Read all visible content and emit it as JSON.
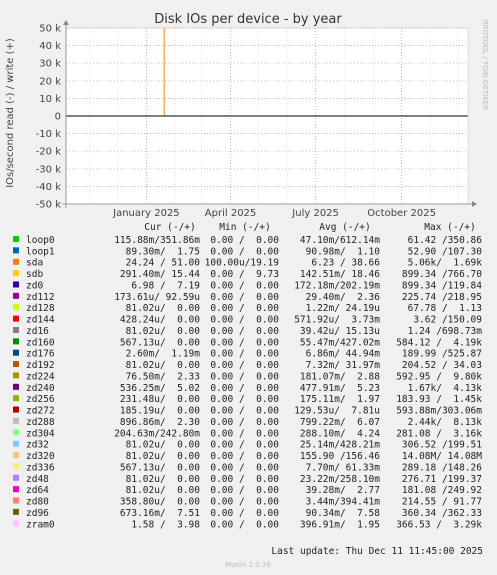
{
  "chart_data": {
    "type": "line",
    "title": "Disk IOs per device - by year",
    "ylabel": "IOs/second read (-) / write (+)",
    "side_label": "RRDTOOL / TOBI OETIKER",
    "ylim": [
      -50000,
      50000
    ],
    "y_ticks": [
      {
        "value": 50000,
        "label": "50 k"
      },
      {
        "value": 40000,
        "label": "40 k"
      },
      {
        "value": 30000,
        "label": "30 k"
      },
      {
        "value": 20000,
        "label": "20 k"
      },
      {
        "value": 10000,
        "label": "10 k"
      },
      {
        "value": 0,
        "label": "0"
      },
      {
        "value": -10000,
        "label": "-10 k"
      },
      {
        "value": -20000,
        "label": "-20 k"
      },
      {
        "value": -30000,
        "label": "-30 k"
      },
      {
        "value": -40000,
        "label": "-40 k"
      },
      {
        "value": -50000,
        "label": "-50 k"
      }
    ],
    "x_range": [
      "2024-10-07",
      "2025-12-11"
    ],
    "x_ticks": [
      {
        "value": "2025-01-01",
        "label": "January 2025"
      },
      {
        "value": "2025-04-01",
        "label": "April 2025"
      },
      {
        "value": "2025-07-01",
        "label": "July 2025"
      },
      {
        "value": "2025-10-01",
        "label": "October 2025"
      }
    ],
    "minor_x_ticks": [
      "2024-11-01",
      "2024-12-01",
      "2025-02-01",
      "2025-03-01",
      "2025-05-01",
      "2025-06-01",
      "2025-08-01",
      "2025-09-01",
      "2025-11-01",
      "2025-12-01"
    ],
    "spike": {
      "series": "sda",
      "x": "2025-01-20",
      "y": 50000
    },
    "legend_headers": [
      "Cur (-/+)",
      "Min (-/+)",
      "Avg (-/+)",
      "Max (-/+)"
    ],
    "series": [
      {
        "name": "loop0",
        "color": "#00cc00",
        "cur": "115.88m/351.86m",
        "min": "0.00 /  0.00",
        "avg": "47.10m/612.14m",
        "max": "61.42 /350.86"
      },
      {
        "name": "loop1",
        "color": "#0066b3",
        "cur": "89.30m/  1.75",
        "min": "0.00 /  0.00",
        "avg": "90.98m/  1.10",
        "max": "52.90 /107.30"
      },
      {
        "name": "sda",
        "color": "#ff8000",
        "cur": "24.24 / 51.00",
        "min": "100.00u/19.19",
        "avg": "6.23 / 38.66",
        "max": "5.06k/  1.69k"
      },
      {
        "name": "sdb",
        "color": "#ffcc00",
        "cur": "291.40m/ 15.44",
        "min": "0.00 /  9.73",
        "avg": "142.51m/ 18.46",
        "max": "899.34 /766.70"
      },
      {
        "name": "zd0",
        "color": "#330099",
        "cur": "6.98 /  7.19",
        "min": "0.00 /  0.00",
        "avg": "172.18m/202.19m",
        "max": "899.34 /119.84"
      },
      {
        "name": "zd112",
        "color": "#990099",
        "cur": "173.61u/ 92.59u",
        "min": "0.00 /  0.00",
        "avg": "29.40m/  2.36",
        "max": "225.74 /218.95"
      },
      {
        "name": "zd128",
        "color": "#ccff00",
        "cur": "81.02u/  0.00",
        "min": "0.00 /  0.00",
        "avg": "1.22m/ 24.19u",
        "max": "67.78 /  1.13"
      },
      {
        "name": "zd144",
        "color": "#ff0000",
        "cur": "428.24u/  0.00",
        "min": "0.00 /  0.00",
        "avg": "571.92u/  3.73m",
        "max": "3.62 /150.09"
      },
      {
        "name": "zd16",
        "color": "#808080",
        "cur": "81.02u/  0.00",
        "min": "0.00 /  0.00",
        "avg": "39.42u/ 15.13u",
        "max": "1.24 /698.73m"
      },
      {
        "name": "zd160",
        "color": "#008f00",
        "cur": "567.13u/  0.00",
        "min": "0.00 /  0.00",
        "avg": "55.47m/427.02m",
        "max": "584.12 /  4.19k"
      },
      {
        "name": "zd176",
        "color": "#00487d",
        "cur": "2.60m/  1.19m",
        "min": "0.00 /  0.00",
        "avg": "6.86m/ 44.94m",
        "max": "189.99 /525.87"
      },
      {
        "name": "zd192",
        "color": "#b35a00",
        "cur": "81.02u/  0.00",
        "min": "0.00 /  0.00",
        "avg": "7.32m/ 31.97m",
        "max": "204.52 / 34.03"
      },
      {
        "name": "zd224",
        "color": "#b38f00",
        "cur": "76.50m/  2.33",
        "min": "0.00 /  0.00",
        "avg": "181.07m/  2.88",
        "max": "592.95 /  9.80k"
      },
      {
        "name": "zd240",
        "color": "#6b006b",
        "cur": "536.25m/  5.02",
        "min": "0.00 /  0.00",
        "avg": "477.91m/  5.23",
        "max": "1.67k/  4.13k"
      },
      {
        "name": "zd256",
        "color": "#8fb300",
        "cur": "231.48u/  0.00",
        "min": "0.00 /  0.00",
        "avg": "175.11m/  1.97",
        "max": "183.93 /  1.45k"
      },
      {
        "name": "zd272",
        "color": "#b30000",
        "cur": "185.19u/  0.00",
        "min": "0.00 /  0.00",
        "avg": "129.53u/  7.81u",
        "max": "593.88m/303.06m"
      },
      {
        "name": "zd288",
        "color": "#bebebe",
        "cur": "896.86m/  2.30",
        "min": "0.00 /  0.00",
        "avg": "799.22m/  6.07",
        "max": "2.44k/  8.13k"
      },
      {
        "name": "zd304",
        "color": "#80ff80",
        "cur": "204.63m/242.80m",
        "min": "0.00 /  0.00",
        "avg": "288.10m/  4.24",
        "max": "281.08 /  3.16k"
      },
      {
        "name": "zd32",
        "color": "#80c9ff",
        "cur": "81.02u/  0.00",
        "min": "0.00 /  0.00",
        "avg": "25.14m/428.21m",
        "max": "306.52 /199.51"
      },
      {
        "name": "zd320",
        "color": "#ffc080",
        "cur": "81.02u/  0.00",
        "min": "0.00 /  0.00",
        "avg": "155.90 /156.46",
        "max": "14.08M/ 14.08M"
      },
      {
        "name": "zd336",
        "color": "#ffe680",
        "cur": "567.13u/  0.00",
        "min": "0.00 /  0.00",
        "avg": "7.70m/ 61.33m",
        "max": "289.18 /148.26"
      },
      {
        "name": "zd48",
        "color": "#aa80ff",
        "cur": "81.02u/  0.00",
        "min": "0.00 /  0.00",
        "avg": "23.22m/258.10m",
        "max": "276.71 /199.37"
      },
      {
        "name": "zd64",
        "color": "#ee00cc",
        "cur": "81.02u/  0.00",
        "min": "0.00 /  0.00",
        "avg": "39.28m/  2.77",
        "max": "181.08 /249.92"
      },
      {
        "name": "zd80",
        "color": "#ff8080",
        "cur": "358.80u/  0.00",
        "min": "0.00 /  0.00",
        "avg": "3.44m/394.41m",
        "max": "214.55 / 91.77"
      },
      {
        "name": "zd96",
        "color": "#666600",
        "cur": "673.16m/  7.51",
        "min": "0.00 /  0.00",
        "avg": "90.34m/  7.58",
        "max": "360.34 /362.33"
      },
      {
        "name": "zram0",
        "color": "#ffbfff",
        "cur": "1.58 /  3.98",
        "min": "0.00 /  0.00",
        "avg": "396.91m/  1.95",
        "max": "366.53 /  3.29k"
      }
    ],
    "last_update": "Last update: Thu Dec 11 11:45:00 2025",
    "footer": "Munin 2.0.76"
  }
}
